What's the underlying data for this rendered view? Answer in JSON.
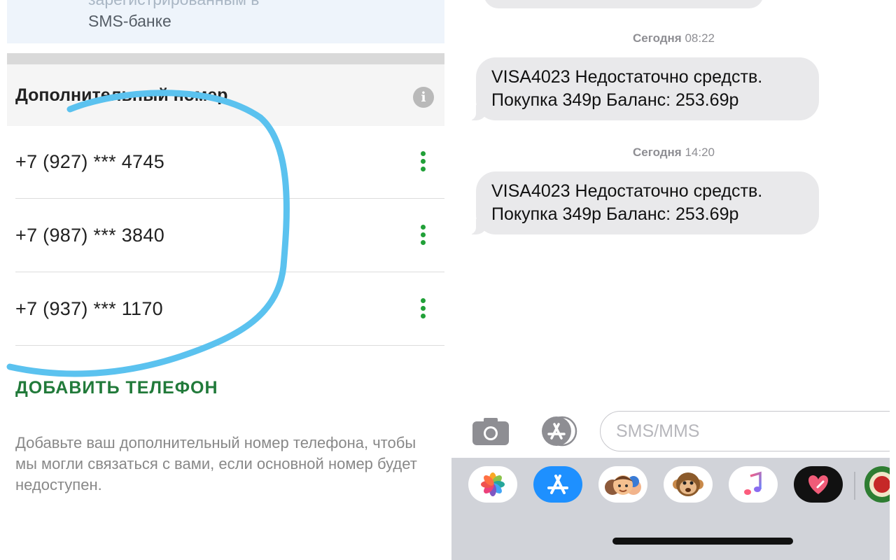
{
  "bank_app": {
    "top_card": {
      "cut_text": "зарегистрированным в",
      "sms_bank_text": "SMS-банке"
    },
    "section_title": "Дополнительный номер",
    "phones": [
      {
        "number": "+7 (927) *** 4745"
      },
      {
        "number": "+7 (987) *** 3840"
      },
      {
        "number": "+7 (937) *** 1170"
      }
    ],
    "add_phone_label": "ДОБАВИТЬ ТЕЛЕФОН",
    "hint_text": "Добавьте ваш дополнительный номер телефона, чтобы мы могли связаться с вами, если основной номер будет недоступен.",
    "colors": {
      "accent_green": "#21a038",
      "add_button_green": "#217a3a",
      "scribble_blue": "#5bc2ef"
    }
  },
  "messages": {
    "items": [
      {
        "day": "Сегодня",
        "time": "08:22",
        "text": "VISA4023 Недостаточно средств. Покупка 349р Баланс: 253.69р"
      },
      {
        "day": "Сегодня",
        "time": "14:20",
        "text": "VISA4023 Недостаточно средств. Покупка 349р Баланс: 253.69р"
      }
    ],
    "input_placeholder": "SMS/MMS",
    "bubble_color": "#e9e9eb"
  },
  "app_tray": {
    "apps": [
      {
        "icon": "photos-icon"
      },
      {
        "icon": "app-store-icon"
      },
      {
        "icon": "memoji-icon"
      },
      {
        "icon": "animoji-monkey-icon"
      },
      {
        "icon": "music-icon"
      },
      {
        "icon": "digital-touch-icon"
      },
      {
        "icon": "sticker-app-icon"
      }
    ]
  }
}
